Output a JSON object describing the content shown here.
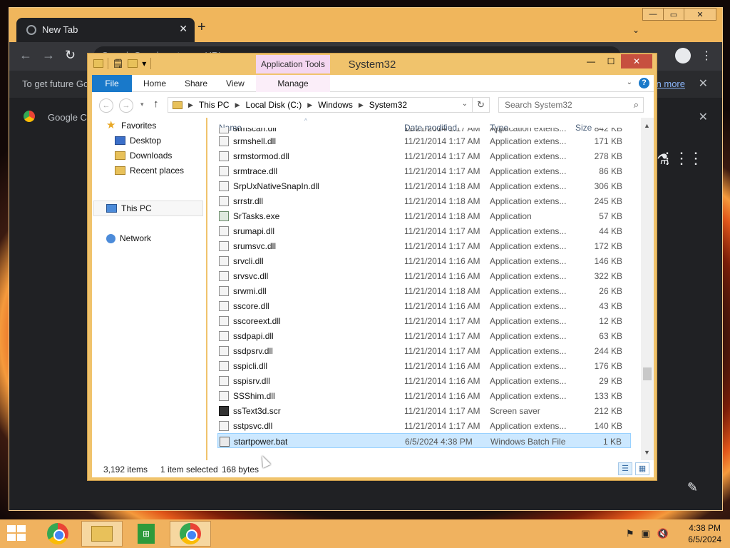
{
  "chrome": {
    "tab_title": "New Tab",
    "omnibox_placeholder": "Search Google or type a URL",
    "infobar_text": "To get future Google Chrome updates, you'll need Windows 10 or later.",
    "infobar_link": "Learn more",
    "banner_text": "Google Chrome"
  },
  "explorer": {
    "title": "System32",
    "contextual_tab_group": "Application Tools",
    "ribbon_tabs": [
      "File",
      "Home",
      "Share",
      "View",
      "Manage"
    ],
    "breadcrumb": [
      "This PC",
      "Local Disk (C:)",
      "Windows",
      "System32"
    ],
    "search_placeholder": "Search System32",
    "nav": {
      "favorites": "Favorites",
      "desktop": "Desktop",
      "downloads": "Downloads",
      "recent_places": "Recent places",
      "this_pc": "This PC",
      "network": "Network"
    },
    "columns": {
      "name": "Name",
      "date": "Date modified",
      "type": "Type",
      "size": "Size"
    },
    "partial_row": {
      "name": "srmscan.dll",
      "date": "11/21/2014 1:17 AM",
      "type": "Application extens...",
      "size": "842 KB"
    },
    "files": [
      {
        "name": "srmshell.dll",
        "date": "11/21/2014 1:17 AM",
        "type": "Application extens...",
        "size": "171 KB",
        "kind": "dll"
      },
      {
        "name": "srmstormod.dll",
        "date": "11/21/2014 1:17 AM",
        "type": "Application extens...",
        "size": "278 KB",
        "kind": "dll"
      },
      {
        "name": "srmtrace.dll",
        "date": "11/21/2014 1:17 AM",
        "type": "Application extens...",
        "size": "86 KB",
        "kind": "dll"
      },
      {
        "name": "SrpUxNativeSnapIn.dll",
        "date": "11/21/2014 1:18 AM",
        "type": "Application extens...",
        "size": "306 KB",
        "kind": "dll"
      },
      {
        "name": "srrstr.dll",
        "date": "11/21/2014 1:18 AM",
        "type": "Application extens...",
        "size": "245 KB",
        "kind": "dll"
      },
      {
        "name": "SrTasks.exe",
        "date": "11/21/2014 1:18 AM",
        "type": "Application",
        "size": "57 KB",
        "kind": "exe"
      },
      {
        "name": "srumapi.dll",
        "date": "11/21/2014 1:17 AM",
        "type": "Application extens...",
        "size": "44 KB",
        "kind": "dll"
      },
      {
        "name": "srumsvc.dll",
        "date": "11/21/2014 1:17 AM",
        "type": "Application extens...",
        "size": "172 KB",
        "kind": "dll"
      },
      {
        "name": "srvcli.dll",
        "date": "11/21/2014 1:16 AM",
        "type": "Application extens...",
        "size": "146 KB",
        "kind": "dll"
      },
      {
        "name": "srvsvc.dll",
        "date": "11/21/2014 1:16 AM",
        "type": "Application extens...",
        "size": "322 KB",
        "kind": "dll"
      },
      {
        "name": "srwmi.dll",
        "date": "11/21/2014 1:18 AM",
        "type": "Application extens...",
        "size": "26 KB",
        "kind": "dll"
      },
      {
        "name": "sscore.dll",
        "date": "11/21/2014 1:16 AM",
        "type": "Application extens...",
        "size": "43 KB",
        "kind": "dll"
      },
      {
        "name": "sscoreext.dll",
        "date": "11/21/2014 1:17 AM",
        "type": "Application extens...",
        "size": "12 KB",
        "kind": "dll"
      },
      {
        "name": "ssdpapi.dll",
        "date": "11/21/2014 1:17 AM",
        "type": "Application extens...",
        "size": "63 KB",
        "kind": "dll"
      },
      {
        "name": "ssdpsrv.dll",
        "date": "11/21/2014 1:17 AM",
        "type": "Application extens...",
        "size": "244 KB",
        "kind": "dll"
      },
      {
        "name": "sspicli.dll",
        "date": "11/21/2014 1:16 AM",
        "type": "Application extens...",
        "size": "176 KB",
        "kind": "dll"
      },
      {
        "name": "sspisrv.dll",
        "date": "11/21/2014 1:16 AM",
        "type": "Application extens...",
        "size": "29 KB",
        "kind": "dll"
      },
      {
        "name": "SSShim.dll",
        "date": "11/21/2014 1:16 AM",
        "type": "Application extens...",
        "size": "133 KB",
        "kind": "dll"
      },
      {
        "name": "ssText3d.scr",
        "date": "11/21/2014 1:17 AM",
        "type": "Screen saver",
        "size": "212 KB",
        "kind": "scr"
      },
      {
        "name": "sstpsvc.dll",
        "date": "11/21/2014 1:17 AM",
        "type": "Application extens...",
        "size": "140 KB",
        "kind": "dll"
      },
      {
        "name": "startpower.bat",
        "date": "6/5/2024 4:38 PM",
        "type": "Windows Batch File",
        "size": "1 KB",
        "kind": "bat",
        "selected": true
      }
    ],
    "status": {
      "item_count": "3,192 items",
      "selection": "1 item selected",
      "selection_size": "168 bytes"
    }
  },
  "taskbar": {
    "time": "4:38 PM",
    "date": "6/5/2024"
  }
}
